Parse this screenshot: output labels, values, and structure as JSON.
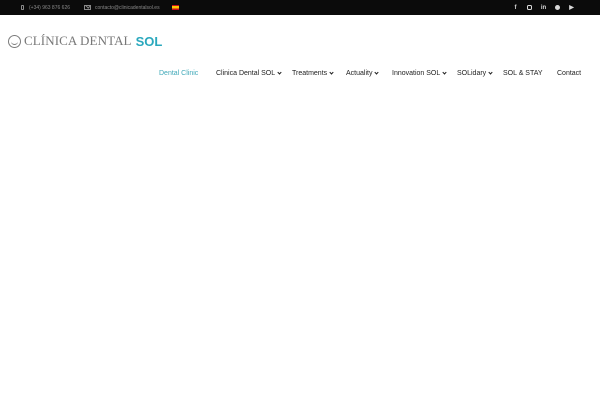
{
  "topbar": {
    "phone": "(+34) 963 876 626",
    "email": "contacto@clinicadentalsol.es",
    "language_flag": "spanish-flag",
    "social": [
      {
        "name": "facebook-icon",
        "glyph": "f"
      },
      {
        "name": "instagram-icon",
        "glyph": ""
      },
      {
        "name": "linkedin-icon",
        "glyph": "in"
      },
      {
        "name": "pinterest-icon",
        "glyph": ""
      },
      {
        "name": "youtube-icon",
        "glyph": "▶"
      }
    ]
  },
  "logo": {
    "text": "CLÍNICA DENTAL",
    "accent": "SOL",
    "accent_color": "#2aa8bd"
  },
  "nav": {
    "items": [
      {
        "label": "Dental Clinic",
        "active": true,
        "dropdown": false
      },
      {
        "label": "Clinica Dental SOL",
        "active": false,
        "dropdown": true
      },
      {
        "label": "Treatments",
        "active": false,
        "dropdown": true
      },
      {
        "label": "Actuality",
        "active": false,
        "dropdown": true
      },
      {
        "label": "Innovation SOL",
        "active": false,
        "dropdown": true
      },
      {
        "label": "SOLidary",
        "active": false,
        "dropdown": true
      },
      {
        "label": "SOL & STAY",
        "active": false,
        "dropdown": false
      },
      {
        "label": "Contact",
        "active": false,
        "dropdown": false
      }
    ],
    "active_color": "#3fa8b8"
  }
}
